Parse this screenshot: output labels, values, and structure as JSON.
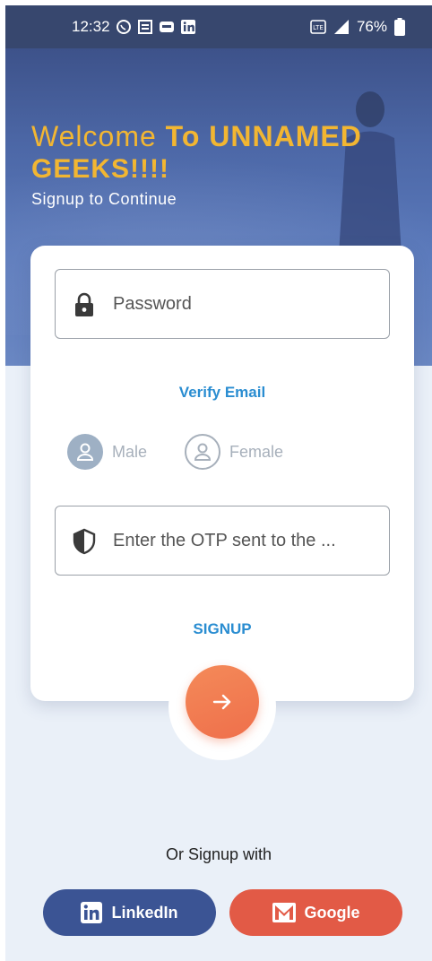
{
  "status_bar": {
    "time": "12:32",
    "battery": "76%"
  },
  "hero": {
    "welcome": "Welcome",
    "brand_line1": "To UNNAMED",
    "brand_line2": "GEEKS!!!!",
    "subtitle": "Signup to Continue"
  },
  "form": {
    "password_placeholder": "Password",
    "verify_email_label": "Verify Email",
    "gender_options": [
      "Male",
      "Female"
    ],
    "otp_placeholder": "Enter the OTP sent to the ...",
    "signup_label": "SIGNUP"
  },
  "social": {
    "or_text": "Or Signup with",
    "linkedin_label": "LinkedIn",
    "google_label": "Google"
  },
  "colors": {
    "accent": "#f2b632",
    "link": "#2a8dd1",
    "fab": "#ef6f4b",
    "linkedin": "#3b5494",
    "google": "#e25a46"
  }
}
